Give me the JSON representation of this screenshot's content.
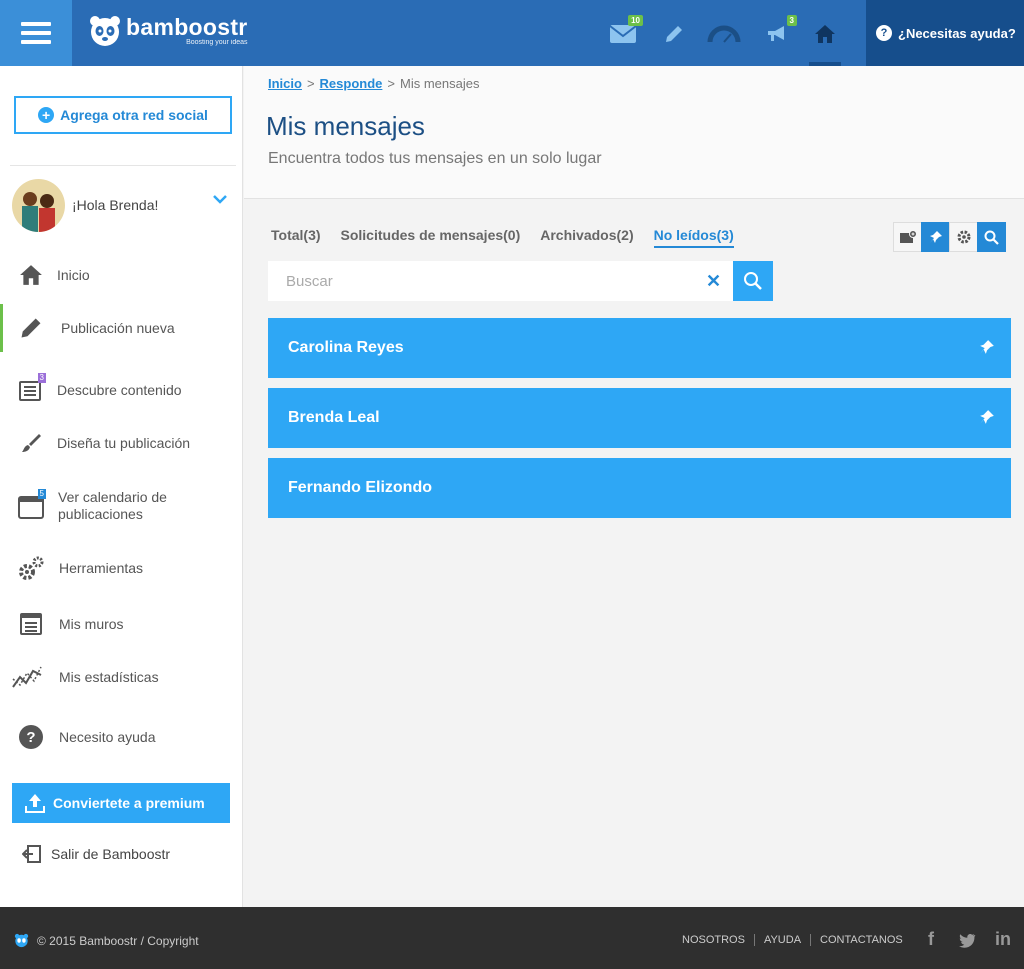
{
  "header": {
    "brand_name": "bamboostr",
    "brand_tagline": "Boosting your ideas",
    "messages_badge": "10",
    "campaign_badge": "3",
    "help_label": "¿Necesitas ayuda?",
    "icons": [
      "menu-icon",
      "mail-icon",
      "pencil-icon",
      "gauge-icon",
      "megaphone-icon",
      "home-icon",
      "help-icon"
    ]
  },
  "sidebar": {
    "add_social_label": "Agrega otra red social",
    "greeting": "¡Hola Brenda!",
    "items": [
      {
        "label": "Inicio",
        "icon": "home-icon"
      },
      {
        "label": "Publicación nueva",
        "icon": "pencil-icon"
      },
      {
        "label": "Descubre contenido",
        "icon": "newspaper-icon",
        "badge": "3"
      },
      {
        "label": "Diseña tu publicación",
        "icon": "brush-icon"
      },
      {
        "label": "Ver calendario de publicaciones",
        "icon": "calendar-icon",
        "badge": "5"
      },
      {
        "label": "Herramientas",
        "icon": "gears-icon"
      },
      {
        "label": "Mis muros",
        "icon": "list-icon"
      },
      {
        "label": "Mis estadísticas",
        "icon": "chart-icon"
      },
      {
        "label": "Necesito ayuda",
        "icon": "question-icon"
      }
    ],
    "premium_label": "Conviertete a premium",
    "logout_label": "Salir de Bamboostr"
  },
  "main": {
    "breadcrumb": {
      "home": "Inicio",
      "section": "Responde",
      "current": "Mis mensajes"
    },
    "title": "Mis mensajes",
    "subtitle": "Encuentra todos tus mensajes en un solo lugar",
    "tabs": [
      {
        "label": "Total(3)"
      },
      {
        "label": "Solicitudes de mensajes(0)"
      },
      {
        "label": "Archivados(2)"
      },
      {
        "label": "No leídos(3)"
      }
    ],
    "search_placeholder": "Buscar",
    "messages": [
      {
        "name": "Carolina Reyes",
        "pinned": true
      },
      {
        "name": "Brenda Leal",
        "pinned": true
      },
      {
        "name": "Fernando Elizondo",
        "pinned": false
      }
    ]
  },
  "footer": {
    "copyright": "© 2015 Bamboostr / Copyright",
    "links": [
      "NOSOTROS",
      "AYUDA",
      "CONTACTANOS"
    ],
    "social": [
      "f",
      "twitter-icon",
      "in"
    ]
  },
  "colors": {
    "topbar": "#2a6cb5",
    "accent": "#2ea7f5",
    "dark_blue": "#164e8c",
    "badge_green": "#6cc04a",
    "badge_purple": "#9b6fd9",
    "footer": "#2f2f2f"
  }
}
